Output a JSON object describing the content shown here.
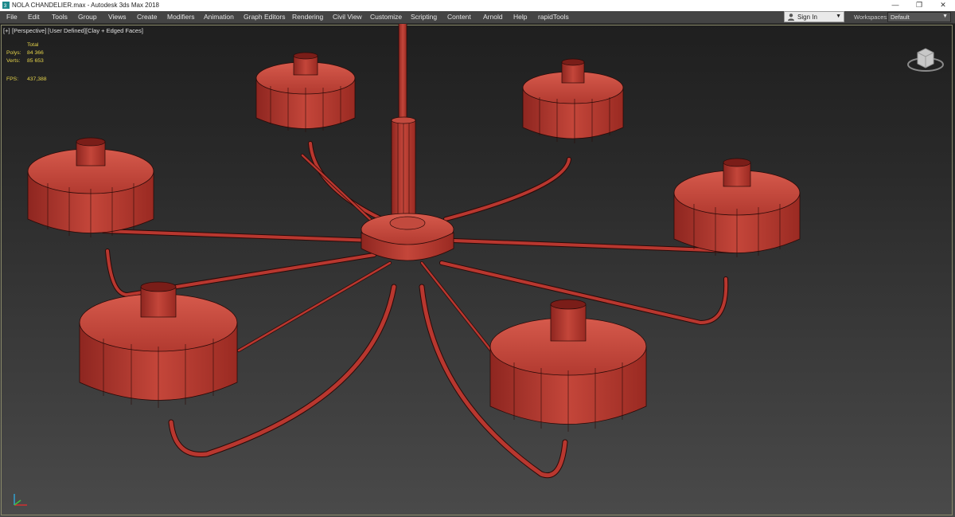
{
  "window": {
    "title": "NOLA CHANDELIER.max - Autodesk 3ds Max 2018",
    "app_icon": "3ds-max-icon",
    "controls": [
      "minimize-icon",
      "restore-icon",
      "close-icon"
    ]
  },
  "menu": {
    "items": [
      "File",
      "Edit",
      "Tools",
      "Group",
      "Views",
      "Create",
      "Modifiers",
      "Animation",
      "Graph Editors",
      "Rendering",
      "Civil View",
      "Customize",
      "Scripting",
      "Content",
      "Arnold",
      "Help",
      "rapidTools"
    ]
  },
  "signin": {
    "label": "Sign In",
    "icon": "user-icon"
  },
  "workspaces": {
    "label": "Workspaces:",
    "value": "Default"
  },
  "viewport": {
    "labels": [
      "[+]",
      "[Perspective]",
      "[User Defined]",
      "[Clay + Edged Faces]"
    ],
    "stats": {
      "header": "Total",
      "polys_label": "Polys:",
      "polys_value": "84 366",
      "verts_label": "Verts:",
      "verts_value": "85 653",
      "fps_label": "FPS:",
      "fps_value": "437,388"
    },
    "stats_color": "#e4d24a",
    "clay_color": "#b8372f",
    "edge_color": "#2a0a08",
    "viewcube_icon": "viewcube-icon",
    "axis_icon": "axis-tripod-icon"
  }
}
